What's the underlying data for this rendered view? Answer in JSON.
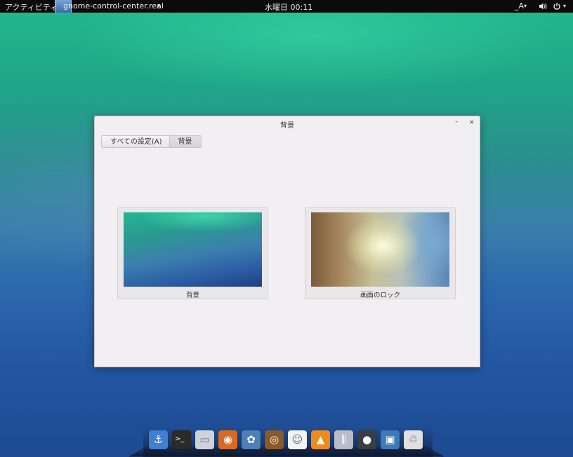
{
  "topbar": {
    "activities": "アクティビティ",
    "app_name": "gnome-control-center.real",
    "app_arrow": "▾",
    "clock": "水曜日 00:11",
    "input_method": "_A",
    "input_arrow": "▾",
    "power_arrow": "▾"
  },
  "window": {
    "title": "背景",
    "minimize": "–",
    "close": "×",
    "breadcrumb": [
      "すべての設定(A)",
      "背景"
    ],
    "cards": [
      {
        "label": "背景"
      },
      {
        "label": "画面のロック"
      }
    ]
  },
  "dock": {
    "items": [
      {
        "name": "anchor-icon",
        "glyph": "⚓",
        "color": "#3f7fd0"
      },
      {
        "name": "terminal-icon",
        "glyph": ">_",
        "color": "#2a2a2a"
      },
      {
        "name": "file-manager-icon",
        "glyph": "▭",
        "color": "#cfd3d8"
      },
      {
        "name": "firefox-icon",
        "glyph": "◉",
        "color": "#d86a23"
      },
      {
        "name": "photo-viewer-icon",
        "glyph": "✿",
        "color": "#4f7fb4"
      },
      {
        "name": "music-player-icon",
        "glyph": "◎",
        "color": "#8a5a2a"
      },
      {
        "name": "messaging-icon",
        "glyph": "☺",
        "color": "#f2f2f2"
      },
      {
        "name": "vlc-icon",
        "glyph": "▲",
        "color": "#f08a1c"
      },
      {
        "name": "mixer-icon",
        "glyph": "⫼",
        "color": "#b8bec8"
      },
      {
        "name": "disc-icon",
        "glyph": "●",
        "color": "#3a3d44"
      },
      {
        "name": "image-editor-icon",
        "glyph": "▣",
        "color": "#3d7ab8"
      },
      {
        "name": "trash-icon",
        "glyph": "♲",
        "color": "#e0e0e0"
      }
    ]
  }
}
